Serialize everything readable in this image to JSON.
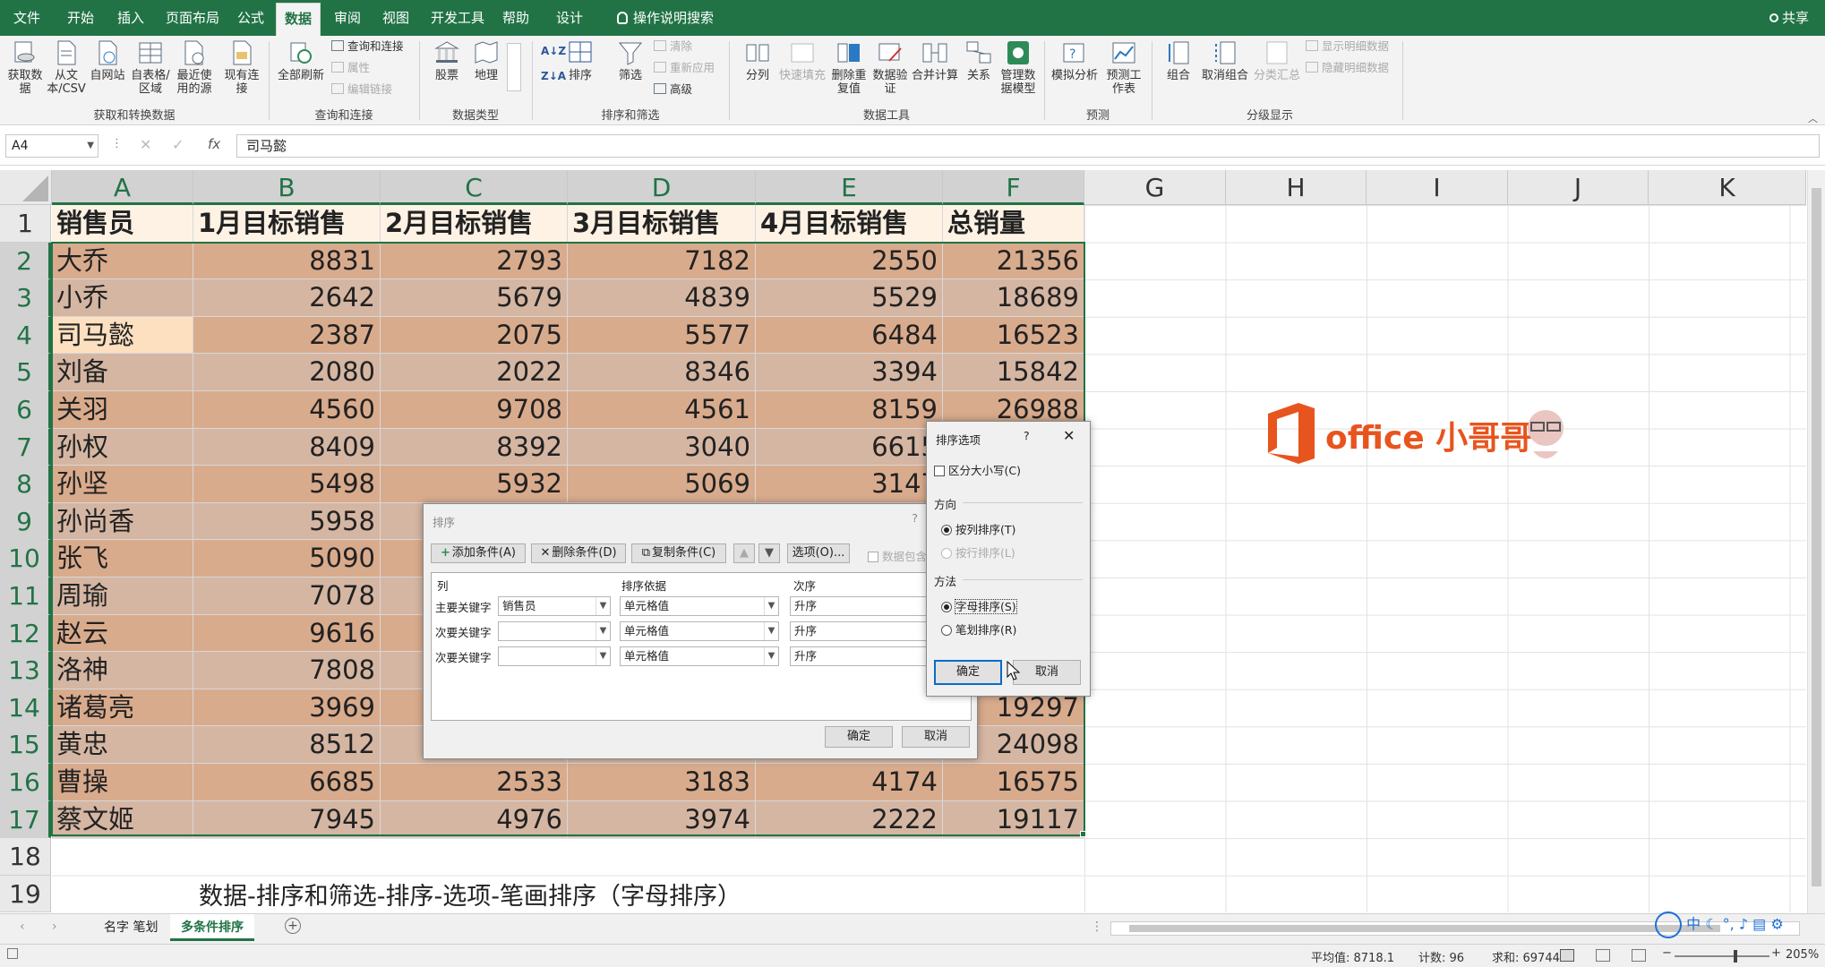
{
  "ribbon_tabs": [
    "文件",
    "开始",
    "插入",
    "页面布局",
    "公式",
    "数据",
    "审阅",
    "视图",
    "开发工具",
    "帮助",
    "设计"
  ],
  "active_tab": "数据",
  "tell_me": "操作说明搜索",
  "share": "共享",
  "groups": {
    "get_transform": {
      "label": "获取和转换数据",
      "buttons": [
        "获取数据",
        "从文本/CSV",
        "自网站",
        "自表格/区域",
        "最近使用的源",
        "现有连接"
      ]
    },
    "queries": {
      "label": "查询和连接",
      "refresh": "全部刷新",
      "items": [
        "查询和连接",
        "属性",
        "编辑链接"
      ]
    },
    "data_types": {
      "label": "数据类型",
      "buttons": [
        "股票",
        "地理"
      ]
    },
    "sort_filter": {
      "label": "排序和筛选",
      "sort": "排序",
      "filter": "筛选",
      "items": [
        "清除",
        "重新应用",
        "高级"
      ]
    },
    "data_tools": {
      "label": "数据工具",
      "buttons": [
        "分列",
        "快速填充",
        "删除重复值",
        "数据验证",
        "合并计算",
        "关系",
        "管理数据模型"
      ]
    },
    "forecast": {
      "label": "预测",
      "buttons": [
        "模拟分析",
        "预测工作表"
      ]
    },
    "outline": {
      "label": "分级显示",
      "buttons": [
        "组合",
        "取消组合",
        "分类汇总"
      ],
      "items": [
        "显示明细数据",
        "隐藏明细数据"
      ]
    }
  },
  "formula_bar": {
    "name_box": "A4",
    "content": "司马懿",
    "fx": "fx"
  },
  "columns": [
    "A",
    "B",
    "C",
    "D",
    "E",
    "F",
    "G",
    "H",
    "I",
    "J",
    "K"
  ],
  "table": {
    "headers": [
      "销售员",
      "1月目标销售",
      "2月目标销售",
      "3月目标销售",
      "4月目标销售",
      "总销量"
    ],
    "rows": [
      [
        "大乔",
        "8831",
        "2793",
        "7182",
        "2550",
        "21356"
      ],
      [
        "小乔",
        "2642",
        "5679",
        "4839",
        "5529",
        "18689"
      ],
      [
        "司马懿",
        "2387",
        "2075",
        "5577",
        "6484",
        "16523"
      ],
      [
        "刘备",
        "2080",
        "2022",
        "8346",
        "3394",
        "15842"
      ],
      [
        "关羽",
        "4560",
        "9708",
        "4561",
        "8159",
        "26988"
      ],
      [
        "孙权",
        "8409",
        "8392",
        "3040",
        "6615",
        ""
      ],
      [
        "孙坚",
        "5498",
        "5932",
        "5069",
        "3147",
        ""
      ],
      [
        "孙尚香",
        "5958",
        "",
        "",
        "",
        ""
      ],
      [
        "张飞",
        "5090",
        "",
        "",
        "",
        ""
      ],
      [
        "周瑜",
        "7078",
        "",
        "",
        "",
        ""
      ],
      [
        "赵云",
        "9616",
        "",
        "",
        "",
        ""
      ],
      [
        "洛神",
        "7808",
        "",
        "",
        "",
        ""
      ],
      [
        "诸葛亮",
        "3969",
        "",
        "",
        "",
        "19297"
      ],
      [
        "黄忠",
        "8512",
        "",
        "",
        "",
        "24098"
      ],
      [
        "曹操",
        "6685",
        "2533",
        "3183",
        "4174",
        "16575"
      ],
      [
        "蔡文姬",
        "7945",
        "4976",
        "3974",
        "2222",
        "19117"
      ]
    ]
  },
  "note_row": {
    "row": "19",
    "text": "数据-排序和筛选-排序-选项-笔画排序（字母排序）"
  },
  "row_numbers": [
    "1",
    "2",
    "3",
    "4",
    "5",
    "6",
    "7",
    "8",
    "9",
    "10",
    "11",
    "12",
    "13",
    "14",
    "15",
    "16",
    "17",
    "18",
    "19"
  ],
  "watermark": "office 小哥哥",
  "sort_dialog": {
    "title": "排序",
    "help": "?",
    "add": "添加条件(A)",
    "delete": "删除条件(D)",
    "copy": "复制条件(C)",
    "options": "选项(O)...",
    "has_header": "数据包含标题",
    "col_header": "列",
    "basis_header": "排序依据",
    "order_header": "次序",
    "rows": [
      {
        "label": "主要关键字",
        "column": "销售员",
        "basis": "单元格值",
        "order": "升序"
      },
      {
        "label": "次要关键字",
        "column": "",
        "basis": "单元格值",
        "order": "升序"
      },
      {
        "label": "次要关键字",
        "column": "",
        "basis": "单元格值",
        "order": "升序"
      }
    ],
    "ok": "确定",
    "cancel": "取消"
  },
  "options_dialog": {
    "title": "排序选项",
    "help": "?",
    "case_sensitive": "区分大小写(C)",
    "direction_label": "方向",
    "dir_col": "按列排序(T)",
    "dir_row": "按行排序(L)",
    "method_label": "方法",
    "method_alpha": "字母排序(S)",
    "method_stroke": "笔划排序(R)",
    "ok": "确定",
    "cancel": "取消"
  },
  "sheets": [
    "名字 笔划",
    "多条件排序"
  ],
  "active_sheet": "多条件排序",
  "status": {
    "average": "平均值: 8718.1",
    "count": "计数: 96",
    "sum": "求和: 697448",
    "zoom": "205%"
  },
  "colors": {
    "excel_green": "#217346",
    "row_odd": "#d9ab8d",
    "row_even": "#d5b6a3",
    "header_bg": "#fdf2e4",
    "logo_orange": "#e8541e"
  }
}
